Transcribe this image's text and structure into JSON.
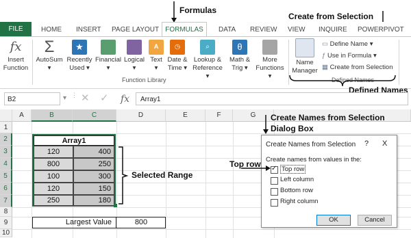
{
  "annotations": {
    "formulas": "Formulas",
    "create_from_selection": "Create from Selection",
    "defined_names": "Defined Names",
    "create_names_dialog_line1": "Create Names from Selection",
    "create_names_dialog_line2": "Dialog Box",
    "top_row": "Top row",
    "selected_range": "Selected Range"
  },
  "tabs": [
    "FILE",
    "HOME",
    "INSERT",
    "PAGE LAYOUT",
    "FORMULAS",
    "DATA",
    "REVIEW",
    "VIEW",
    "INQUIRE",
    "POWERPIVOT"
  ],
  "ribbon": {
    "insert_function": [
      "Insert",
      "Function"
    ],
    "autosum": "AutoSum",
    "recently_used": [
      "Recently",
      "Used"
    ],
    "financial": "Financial",
    "logical": "Logical",
    "text": "Text",
    "date_time": [
      "Date &",
      "Time"
    ],
    "lookup": [
      "Lookup &",
      "Reference"
    ],
    "math": [
      "Math &",
      "Trig"
    ],
    "more": [
      "More",
      "Functions"
    ],
    "function_library_label": "Function Library",
    "name_manager": [
      "Name",
      "Manager"
    ],
    "define_name": "Define Name",
    "use_in_formula": "Use in Formula",
    "create_from_selection": "Create from Selection",
    "defined_names_label": "Defined Names",
    "colors": {
      "accent": "#217346"
    }
  },
  "formula_bar": {
    "name_box": "B2",
    "formula": "Array1"
  },
  "sheet": {
    "columns": [
      "A",
      "B",
      "C",
      "D",
      "E",
      "F",
      "G"
    ],
    "rows": [
      "1",
      "2",
      "3",
      "4",
      "5",
      "6",
      "7",
      "8",
      "9",
      "10"
    ],
    "array_title": "Array1",
    "data": [
      [
        "120",
        "400"
      ],
      [
        "800",
        "250"
      ],
      [
        "100",
        "300"
      ],
      [
        "120",
        "150"
      ],
      [
        "250",
        "180"
      ]
    ],
    "largest_label": "Largest Value",
    "largest_value": "800"
  },
  "dialog": {
    "title": "Create Names from Selection",
    "help": "?",
    "close": "X",
    "prompt": "Create names from values in the:",
    "options": [
      {
        "label": "Top row",
        "checked": true
      },
      {
        "label": "Left column",
        "checked": false
      },
      {
        "label": "Bottom row",
        "checked": false
      },
      {
        "label": "Right column",
        "checked": false
      }
    ],
    "ok": "OK",
    "cancel": "Cancel"
  }
}
